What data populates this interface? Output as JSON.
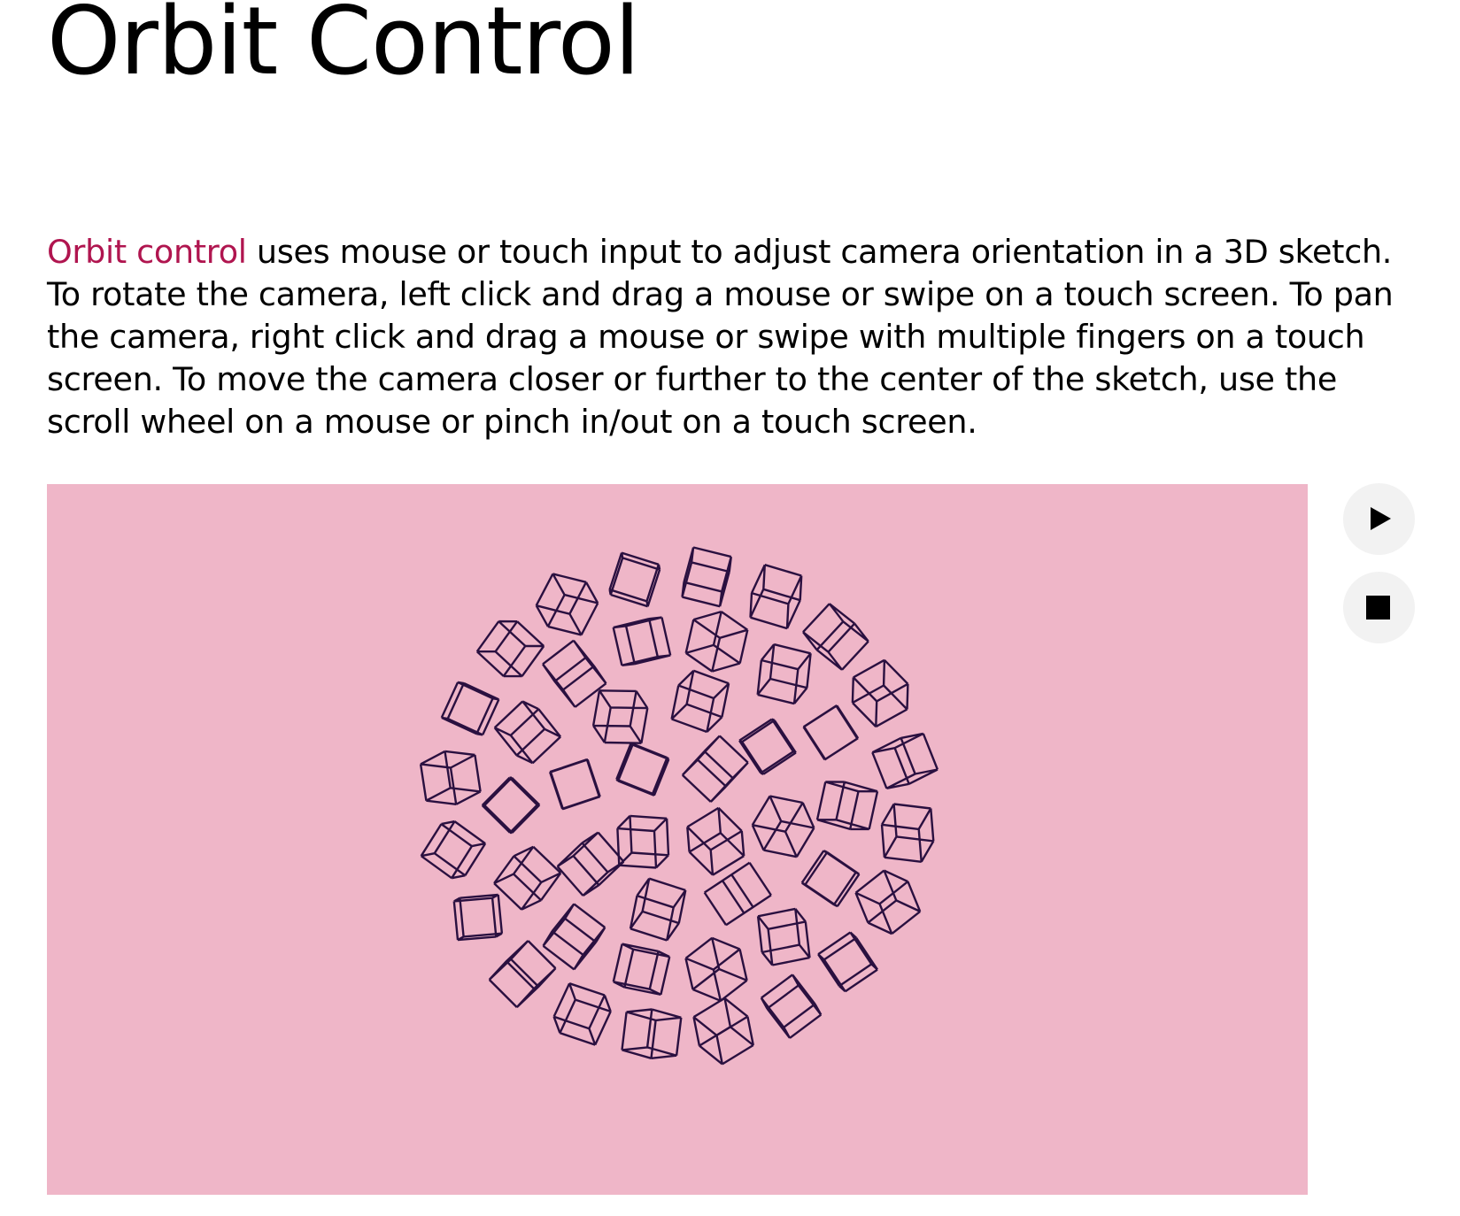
{
  "page": {
    "title": "Orbit Control"
  },
  "description": {
    "link_text": "Orbit control",
    "body_text": " uses mouse or touch input to adjust camera orientation in a 3D sketch. To rotate the camera, left click and drag a mouse or swipe on a touch screen. To pan the camera, right click and drag a mouse or swipe with multiple fingers on a touch screen. To move the camera closer or further to the center of the sketch, use the scroll wheel on a mouse or pinch in/out on a touch screen."
  },
  "sketch": {
    "background_color": "#efb6c8",
    "stroke_color": "#2a1040",
    "shape": "wireframe-box"
  },
  "controls": {
    "play_icon": "play-icon",
    "stop_icon": "stop-icon"
  },
  "colors": {
    "link": "#b0154f",
    "text": "#000000",
    "button_background": "#f2f2f2"
  }
}
